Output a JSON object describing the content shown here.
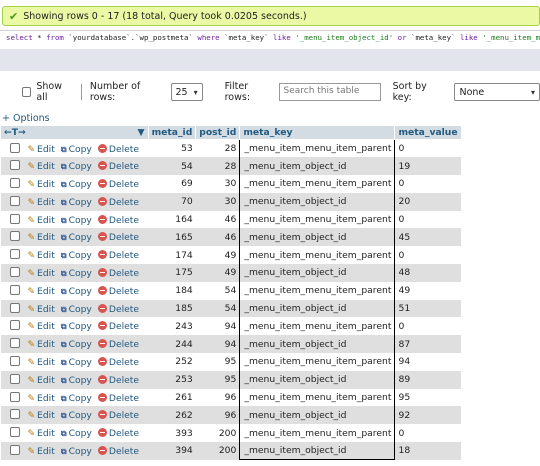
{
  "success": {
    "icon": "check-icon",
    "text": "Showing rows 0 - 17 (18 total, Query took 0.0205 seconds.)"
  },
  "sql": {
    "parts": [
      {
        "t": "select",
        "c": "kw"
      },
      {
        "t": " * ",
        "c": ""
      },
      {
        "t": "from",
        "c": "kw"
      },
      {
        "t": " `yourdatabase`.`wp_postmeta` ",
        "c": ""
      },
      {
        "t": "where",
        "c": "kw"
      },
      {
        "t": " `meta_key` ",
        "c": ""
      },
      {
        "t": "like",
        "c": "kw"
      },
      {
        "t": " '_menu_item_object_id' ",
        "c": "str"
      },
      {
        "t": "or",
        "c": "kw"
      },
      {
        "t": " `meta_key` ",
        "c": ""
      },
      {
        "t": "like",
        "c": "kw"
      },
      {
        "t": " '_menu_item_menu_item_parent'",
        "c": "str"
      }
    ]
  },
  "controls": {
    "show_all": "Show all",
    "num_rows_label": "Number of rows:",
    "num_rows_value": "25",
    "filter_label": "Filter rows:",
    "filter_placeholder": "Search this table",
    "sort_label": "Sort by key:",
    "sort_value": "None"
  },
  "options_link": "+ Options",
  "table": {
    "nav_arrows": "←T→",
    "columns": [
      "meta_id",
      "post_id",
      "meta_key",
      "meta_value"
    ],
    "actions": {
      "edit": "Edit",
      "copy": "Copy",
      "delete": "Delete"
    },
    "rows": [
      [
        "53",
        "28",
        "_menu_item_menu_item_parent",
        "0"
      ],
      [
        "54",
        "28",
        "_menu_item_object_id",
        "19"
      ],
      [
        "69",
        "30",
        "_menu_item_menu_item_parent",
        "0"
      ],
      [
        "70",
        "30",
        "_menu_item_object_id",
        "20"
      ],
      [
        "164",
        "46",
        "_menu_item_menu_item_parent",
        "0"
      ],
      [
        "165",
        "46",
        "_menu_item_object_id",
        "45"
      ],
      [
        "174",
        "49",
        "_menu_item_menu_item_parent",
        "0"
      ],
      [
        "175",
        "49",
        "_menu_item_object_id",
        "48"
      ],
      [
        "184",
        "54",
        "_menu_item_menu_item_parent",
        "49"
      ],
      [
        "185",
        "54",
        "_menu_item_object_id",
        "51"
      ],
      [
        "243",
        "94",
        "_menu_item_menu_item_parent",
        "0"
      ],
      [
        "244",
        "94",
        "_menu_item_object_id",
        "87"
      ],
      [
        "252",
        "95",
        "_menu_item_menu_item_parent",
        "94"
      ],
      [
        "253",
        "95",
        "_menu_item_object_id",
        "89"
      ],
      [
        "261",
        "96",
        "_menu_item_menu_item_parent",
        "95"
      ],
      [
        "262",
        "96",
        "_menu_item_object_id",
        "92"
      ],
      [
        "393",
        "200",
        "_menu_item_menu_item_parent",
        "0"
      ],
      [
        "394",
        "200",
        "_menu_item_object_id",
        "18"
      ]
    ]
  }
}
